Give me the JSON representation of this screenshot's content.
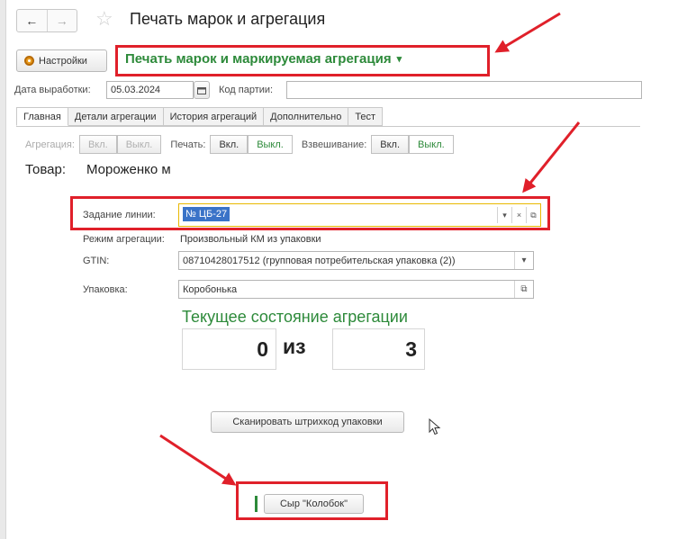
{
  "window": {
    "title": "Печать марок и агрегация"
  },
  "nav": {
    "back": "←",
    "forward": "→",
    "star": "☆"
  },
  "toolbar": {
    "settings_label": "Настройки",
    "print_menu_label": "Печать марок и маркируемая агрегация",
    "print_menu_arrow": "▾"
  },
  "header": {
    "production_date_label": "Дата выработки:",
    "production_date_value": "05.03.2024",
    "batch_code_label": "Код партии:",
    "batch_code_value": ""
  },
  "tabs": [
    "Главная",
    "Детали агрегации",
    "История агрегаций",
    "Дополнительно",
    "Тест"
  ],
  "toggles": {
    "aggregation_label": "Агрегация:",
    "print_label": "Печать:",
    "weighing_label": "Взвешивание:",
    "on": "Вкл.",
    "off": "Выкл."
  },
  "goods": {
    "label": "Товар:",
    "value": "Мороженко м"
  },
  "form": {
    "task_label": "Задание линии:",
    "task_value": "№ ЦБ-27",
    "mode_label": "Режим агрегации:",
    "mode_value": "Произвольный КМ из упаковки",
    "gtin_label": "GTIN:",
    "gtin_value": "08710428017512 (групповая потребительская упаковка (2))",
    "pack_label": "Упаковка:",
    "pack_value": "Коробонька"
  },
  "state": {
    "title": "Текущее состояние агрегации",
    "current": "0",
    "of": "из",
    "total": "3"
  },
  "buttons": {
    "scan_label": "Сканировать штрихкод упаковки",
    "cheese_label": "Сыр \"Колобок\""
  },
  "colors": {
    "accent_green": "#2d8a3a",
    "highlight_red": "#e0202a",
    "selection_blue": "#3a73c8",
    "focus_yellow": "#e9b800"
  },
  "icons": [
    "back-arrow-icon",
    "forward-arrow-icon",
    "favorite-star-icon",
    "gear-icon",
    "calendar-icon",
    "dropdown-arrow-icon",
    "clear-icon",
    "open-icon",
    "mouse-cursor-icon",
    "red-arrow-annotation"
  ]
}
